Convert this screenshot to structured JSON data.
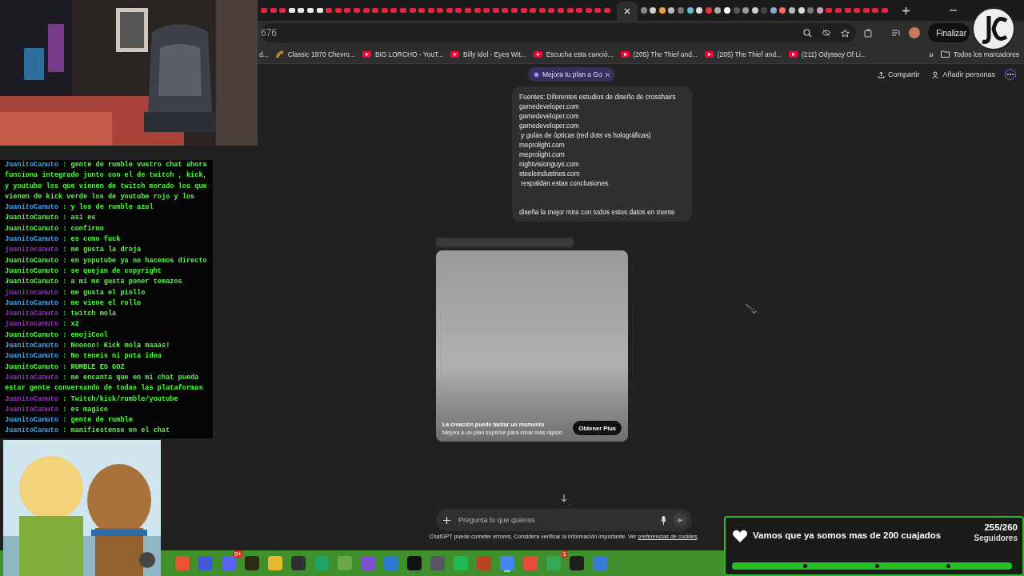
{
  "browser": {
    "address": "676",
    "finish_button": "Finalizar",
    "bookmarks": [
      {
        "label": "d...",
        "kind": "plain"
      },
      {
        "label": "Classic 1970 Chevro...",
        "kind": "site"
      },
      {
        "label": "BIG LORCHO - YouT...",
        "kind": "video"
      },
      {
        "label": "Billy Idol - Eyes Wit...",
        "kind": "video"
      },
      {
        "label": "Escucha esta canció...",
        "kind": "video"
      },
      {
        "label": "(205) The Thief and...",
        "kind": "video"
      },
      {
        "label": "(205) The Thief and...",
        "kind": "video"
      },
      {
        "label": "(211) Odyssey Of Li...",
        "kind": "video"
      }
    ],
    "more_bookmarks": "»",
    "all_bookmarks": "Todos los marcadores"
  },
  "chat_header": {
    "upgrade_pill": "Mejora tu plan a Go",
    "share": "Compartir",
    "add_people": "Añadir personas"
  },
  "message": {
    "lines": [
      "Fuentes: Diferentes estudios de diseño de crosshairs",
      "gamedeveloper.com",
      "gamedeveloper.com",
      "gamedeveloper.com",
      " y guías de ópticas (red dots vs holográficas)",
      "meprolight.com",
      "meprolight.com",
      "nightvisionguys.com",
      "steeleindustries.com",
      " respaldan estas conclusiones."
    ],
    "prompt": "diseña la mejor mira con todos estos datos en mente"
  },
  "image_card": {
    "title": "La creación puede tardar un momento",
    "subtitle": "Mejora a un plan superior para crear más rápido",
    "button": "Obtener Plus"
  },
  "composer": {
    "placeholder": "Pregunta lo que quieras"
  },
  "disclaimer": {
    "text": "ChatGPT puede cometer errores. Considera verificar la información importante. Ver ",
    "link": "preferencias de cookies",
    "end": "."
  },
  "stream_chat": [
    {
      "user": "JuanitoCanuto",
      "color": "#3fa9f5",
      "text": ": gente de rumble vustro chat ahora funciona integrado junto con el de twitch , kick, y youtube los que vienen de twitch morado los que vienen de kick verde los de youtube rojo y los"
    },
    {
      "user": "JuanitoCanuto",
      "color": "#3fa9f5",
      "text": ": y los de rumble azul"
    },
    {
      "user": "JuanitoCanuto",
      "color": "#4cff3c",
      "text": ": asi es"
    },
    {
      "user": "JuanitoCanuto",
      "color": "#4cff3c",
      "text": ": confirmo"
    },
    {
      "user": "JuanitoCanuto",
      "color": "#3fa9f5",
      "text": ": es como fuck"
    },
    {
      "user": "juanitocanuto",
      "color": "#9b2fc4",
      "text": ": me gusta la droja"
    },
    {
      "user": "JuanitoCanuto",
      "color": "#4cff3c",
      "text": ": en yoputube ya no hacemos directo"
    },
    {
      "user": "JuanitoCanuto",
      "color": "#4cff3c",
      "text": ": se quejan de copyright"
    },
    {
      "user": "JuanitoCanuto",
      "color": "#4cff3c",
      "text": ": a mi me gusta poner temazos"
    },
    {
      "user": "juanitocanuto",
      "color": "#9b2fc4",
      "text": ": me gusta el piollo"
    },
    {
      "user": "JuanitoCanuto",
      "color": "#3fa9f5",
      "text": ": me viene el rollo"
    },
    {
      "user": "JuanitoCanuto",
      "color": "#9b2fc4",
      "text": ": twitch mola"
    },
    {
      "user": "juanitocanuto",
      "color": "#9b2fc4",
      "text": ": x2"
    },
    {
      "user": "JuanitoCanuto",
      "color": "#4cff3c",
      "text": ": emojiCool"
    },
    {
      "user": "JuanitoCanuto",
      "color": "#3fa9f5",
      "text": ": Nooooo! Kick mola maaas!"
    },
    {
      "user": "JuanitoCanuto",
      "color": "#3fa9f5",
      "text": ": No teneis ni puta idea"
    },
    {
      "user": "JuanitoCanuto",
      "color": "#4cff3c",
      "text": ": RUMBLE ES GOZ"
    },
    {
      "user": "JuanitoCanuto",
      "color": "#9b2fc4",
      "text": ": me encanta que en mi chat pueda estar gente conversando de todas las plataformas"
    },
    {
      "user": "JuanitoCanuto",
      "color": "#9b2fc4",
      "text": ": Twitch/kick/rumble/youtube"
    },
    {
      "user": "JuanitoCanuto",
      "color": "#9b2fc4",
      "text": ": es magico"
    },
    {
      "user": "JuanitoCanuto",
      "color": "#3fa9f5",
      "text": ": gente de rumble"
    },
    {
      "user": "JuanitoCanuto",
      "color": "#3fa9f5",
      "text": ": manifiestense en el chat"
    }
  ],
  "taskbar": [
    {
      "color": "#e8542c",
      "selected": false
    },
    {
      "color": "#3f5bd8",
      "selected": false
    },
    {
      "color": "#5865f2",
      "badge": "9+",
      "selected": false
    },
    {
      "color": "#2b2b10",
      "selected": false
    },
    {
      "color": "#e8b830",
      "selected": false
    },
    {
      "color": "#303030",
      "selected": false
    },
    {
      "color": "#21a366",
      "selected": false
    },
    {
      "color": "#6aa84f",
      "selected": false
    },
    {
      "color": "#7b4fd0",
      "selected": false
    },
    {
      "color": "#2d7ad6",
      "selected": false
    },
    {
      "color": "#111111",
      "selected": false
    },
    {
      "color": "#555566",
      "selected": false
    },
    {
      "color": "#1db954",
      "selected": false
    },
    {
      "color": "#b5461f",
      "selected": false
    },
    {
      "color": "#4285f4",
      "selected": true
    },
    {
      "color": "#e84a3c",
      "selected": false
    },
    {
      "color": "#34a853",
      "badge": "1",
      "selected": false
    },
    {
      "color": "#1e1e1e",
      "selected": false
    },
    {
      "color": "#3a7bd5",
      "selected": false
    }
  ],
  "follower_goal": {
    "title": "Vamos que ya somos mas de 200 cuajados",
    "count": "255/260",
    "label": "Seguidores",
    "level": 0.98
  }
}
